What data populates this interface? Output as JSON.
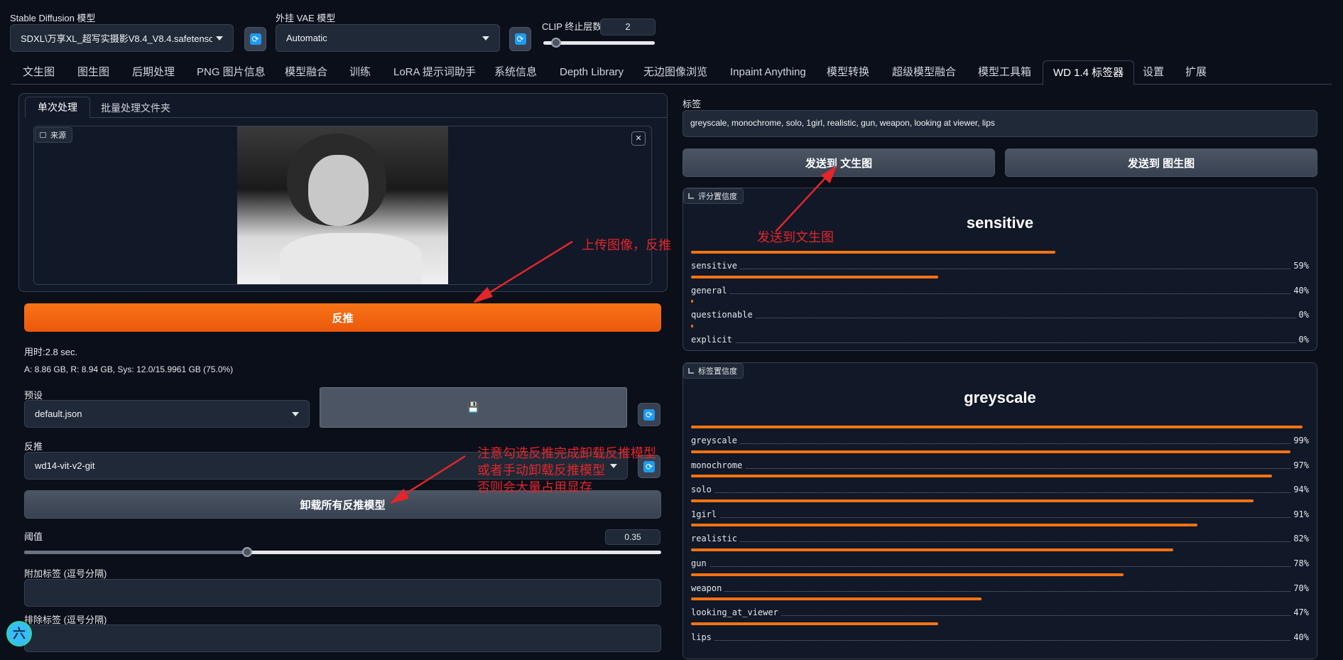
{
  "top": {
    "sd_model_label": "Stable Diffusion 模型",
    "sd_model_value": "SDXL\\万享XL_超写实摄影V8.4_V8.4.safetensors",
    "vae_label": "外挂 VAE 模型",
    "vae_value": "Automatic",
    "clip_label": "CLIP 终止层数",
    "clip_value": "2"
  },
  "tabs": [
    "文生图",
    "图生图",
    "后期处理",
    "PNG 图片信息",
    "模型融合",
    "训练",
    "LoRA 提示词助手",
    "系统信息",
    "Depth Library",
    "无边图像浏览",
    "Inpaint Anything",
    "模型转换",
    "超级模型融合",
    "模型工具箱",
    "WD 1.4 标签器",
    "设置",
    "扩展"
  ],
  "active_tab": "WD 1.4 标签器",
  "left": {
    "subtabs": [
      "单次处理",
      "批量处理文件夹"
    ],
    "source_label": "来源",
    "close_glyph": "✕",
    "interrogate_button": "反推",
    "time_text": "用时:2.8 sec.",
    "mem_text": "A: 8.86 GB, R: 8.94 GB, Sys: 12.0/15.9961 GB (75.0%)",
    "preset_label": "预设",
    "preset_value": "default.json",
    "save_glyph": "💾",
    "interrogator_label": "反推",
    "interrogator_value": "wd14-vit-v2-git",
    "unload_button": "卸载所有反推模型",
    "threshold_label": "阈值",
    "threshold_value": "0.35",
    "threshold_fraction": 0.35,
    "additional_tags_label": "附加标签 (逗号分隔)",
    "exclude_tags_label": "排除标签 (逗号分隔)",
    "floating_badge": "六"
  },
  "right": {
    "tags_label": "标签",
    "tags_value": "greyscale, monochrome, solo, 1girl, realistic, gun, weapon, looking at viewer, lips",
    "send_txt2img": "发送到 文生图",
    "send_img2img": "发送到 图生图",
    "rating_chip": "评分置信度",
    "rating_top": "sensitive",
    "ratings": [
      {
        "name": "sensitive",
        "pct": "59%",
        "value": 0.59
      },
      {
        "name": "general",
        "pct": "40%",
        "value": 0.4
      },
      {
        "name": "questionable",
        "pct": "0%",
        "value": 0.0
      },
      {
        "name": "explicit",
        "pct": "0%",
        "value": 0.0
      }
    ],
    "tag_chip": "标签置信度",
    "tag_top": "greyscale",
    "tags": [
      {
        "name": "greyscale",
        "pct": "99%",
        "value": 0.99
      },
      {
        "name": "monochrome",
        "pct": "97%",
        "value": 0.97
      },
      {
        "name": "solo",
        "pct": "94%",
        "value": 0.94
      },
      {
        "name": "1girl",
        "pct": "91%",
        "value": 0.91
      },
      {
        "name": "realistic",
        "pct": "82%",
        "value": 0.82
      },
      {
        "name": "gun",
        "pct": "78%",
        "value": 0.78
      },
      {
        "name": "weapon",
        "pct": "70%",
        "value": 0.7
      },
      {
        "name": "looking_at_viewer",
        "pct": "47%",
        "value": 0.47
      },
      {
        "name": "lips",
        "pct": "40%",
        "value": 0.4
      }
    ]
  },
  "annotations": {
    "upload": "上传图像，反推",
    "send": "发送到文生图",
    "note_line1": "注意勾选反推完成卸载反推模型",
    "note_line2": "或者手动卸载反推模型",
    "note_line3": "否则会大量占用显存"
  },
  "colors": {
    "accent": "#f97316",
    "annotation": "#e2262b",
    "refresh": "#1d9bf0"
  }
}
